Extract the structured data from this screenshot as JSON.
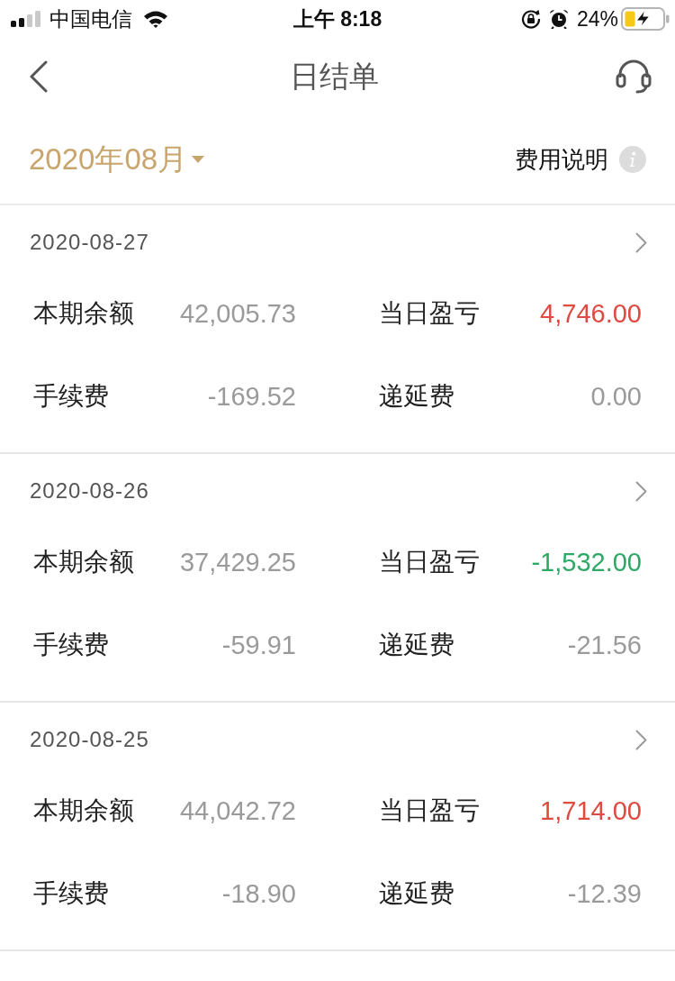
{
  "status_bar": {
    "carrier": "中国电信",
    "time": "上午 8:18",
    "battery": "24%"
  },
  "nav_bar": {
    "title": "日结单"
  },
  "filter_bar": {
    "month": "2020年08月",
    "fee_info": "费用说明"
  },
  "statements": [
    {
      "date": "2020-08-27",
      "items": [
        {
          "label": "本期余额",
          "value": "42,005.73",
          "kind": "plain"
        },
        {
          "label": "当日盈亏",
          "value": "4,746.00",
          "kind": "profit"
        },
        {
          "label": "手续费",
          "value": "-169.52",
          "kind": "plain"
        },
        {
          "label": "递延费",
          "value": "0.00",
          "kind": "plain"
        }
      ]
    },
    {
      "date": "2020-08-26",
      "items": [
        {
          "label": "本期余额",
          "value": "37,429.25",
          "kind": "plain"
        },
        {
          "label": "当日盈亏",
          "value": "-1,532.00",
          "kind": "loss"
        },
        {
          "label": "手续费",
          "value": "-59.91",
          "kind": "plain"
        },
        {
          "label": "递延费",
          "value": "-21.56",
          "kind": "plain"
        }
      ]
    },
    {
      "date": "2020-08-25",
      "items": [
        {
          "label": "本期余额",
          "value": "44,042.72",
          "kind": "plain"
        },
        {
          "label": "当日盈亏",
          "value": "1,714.00",
          "kind": "profit"
        },
        {
          "label": "手续费",
          "value": "-18.90",
          "kind": "plain"
        },
        {
          "label": "递延费",
          "value": "-12.39",
          "kind": "plain"
        }
      ]
    }
  ]
}
